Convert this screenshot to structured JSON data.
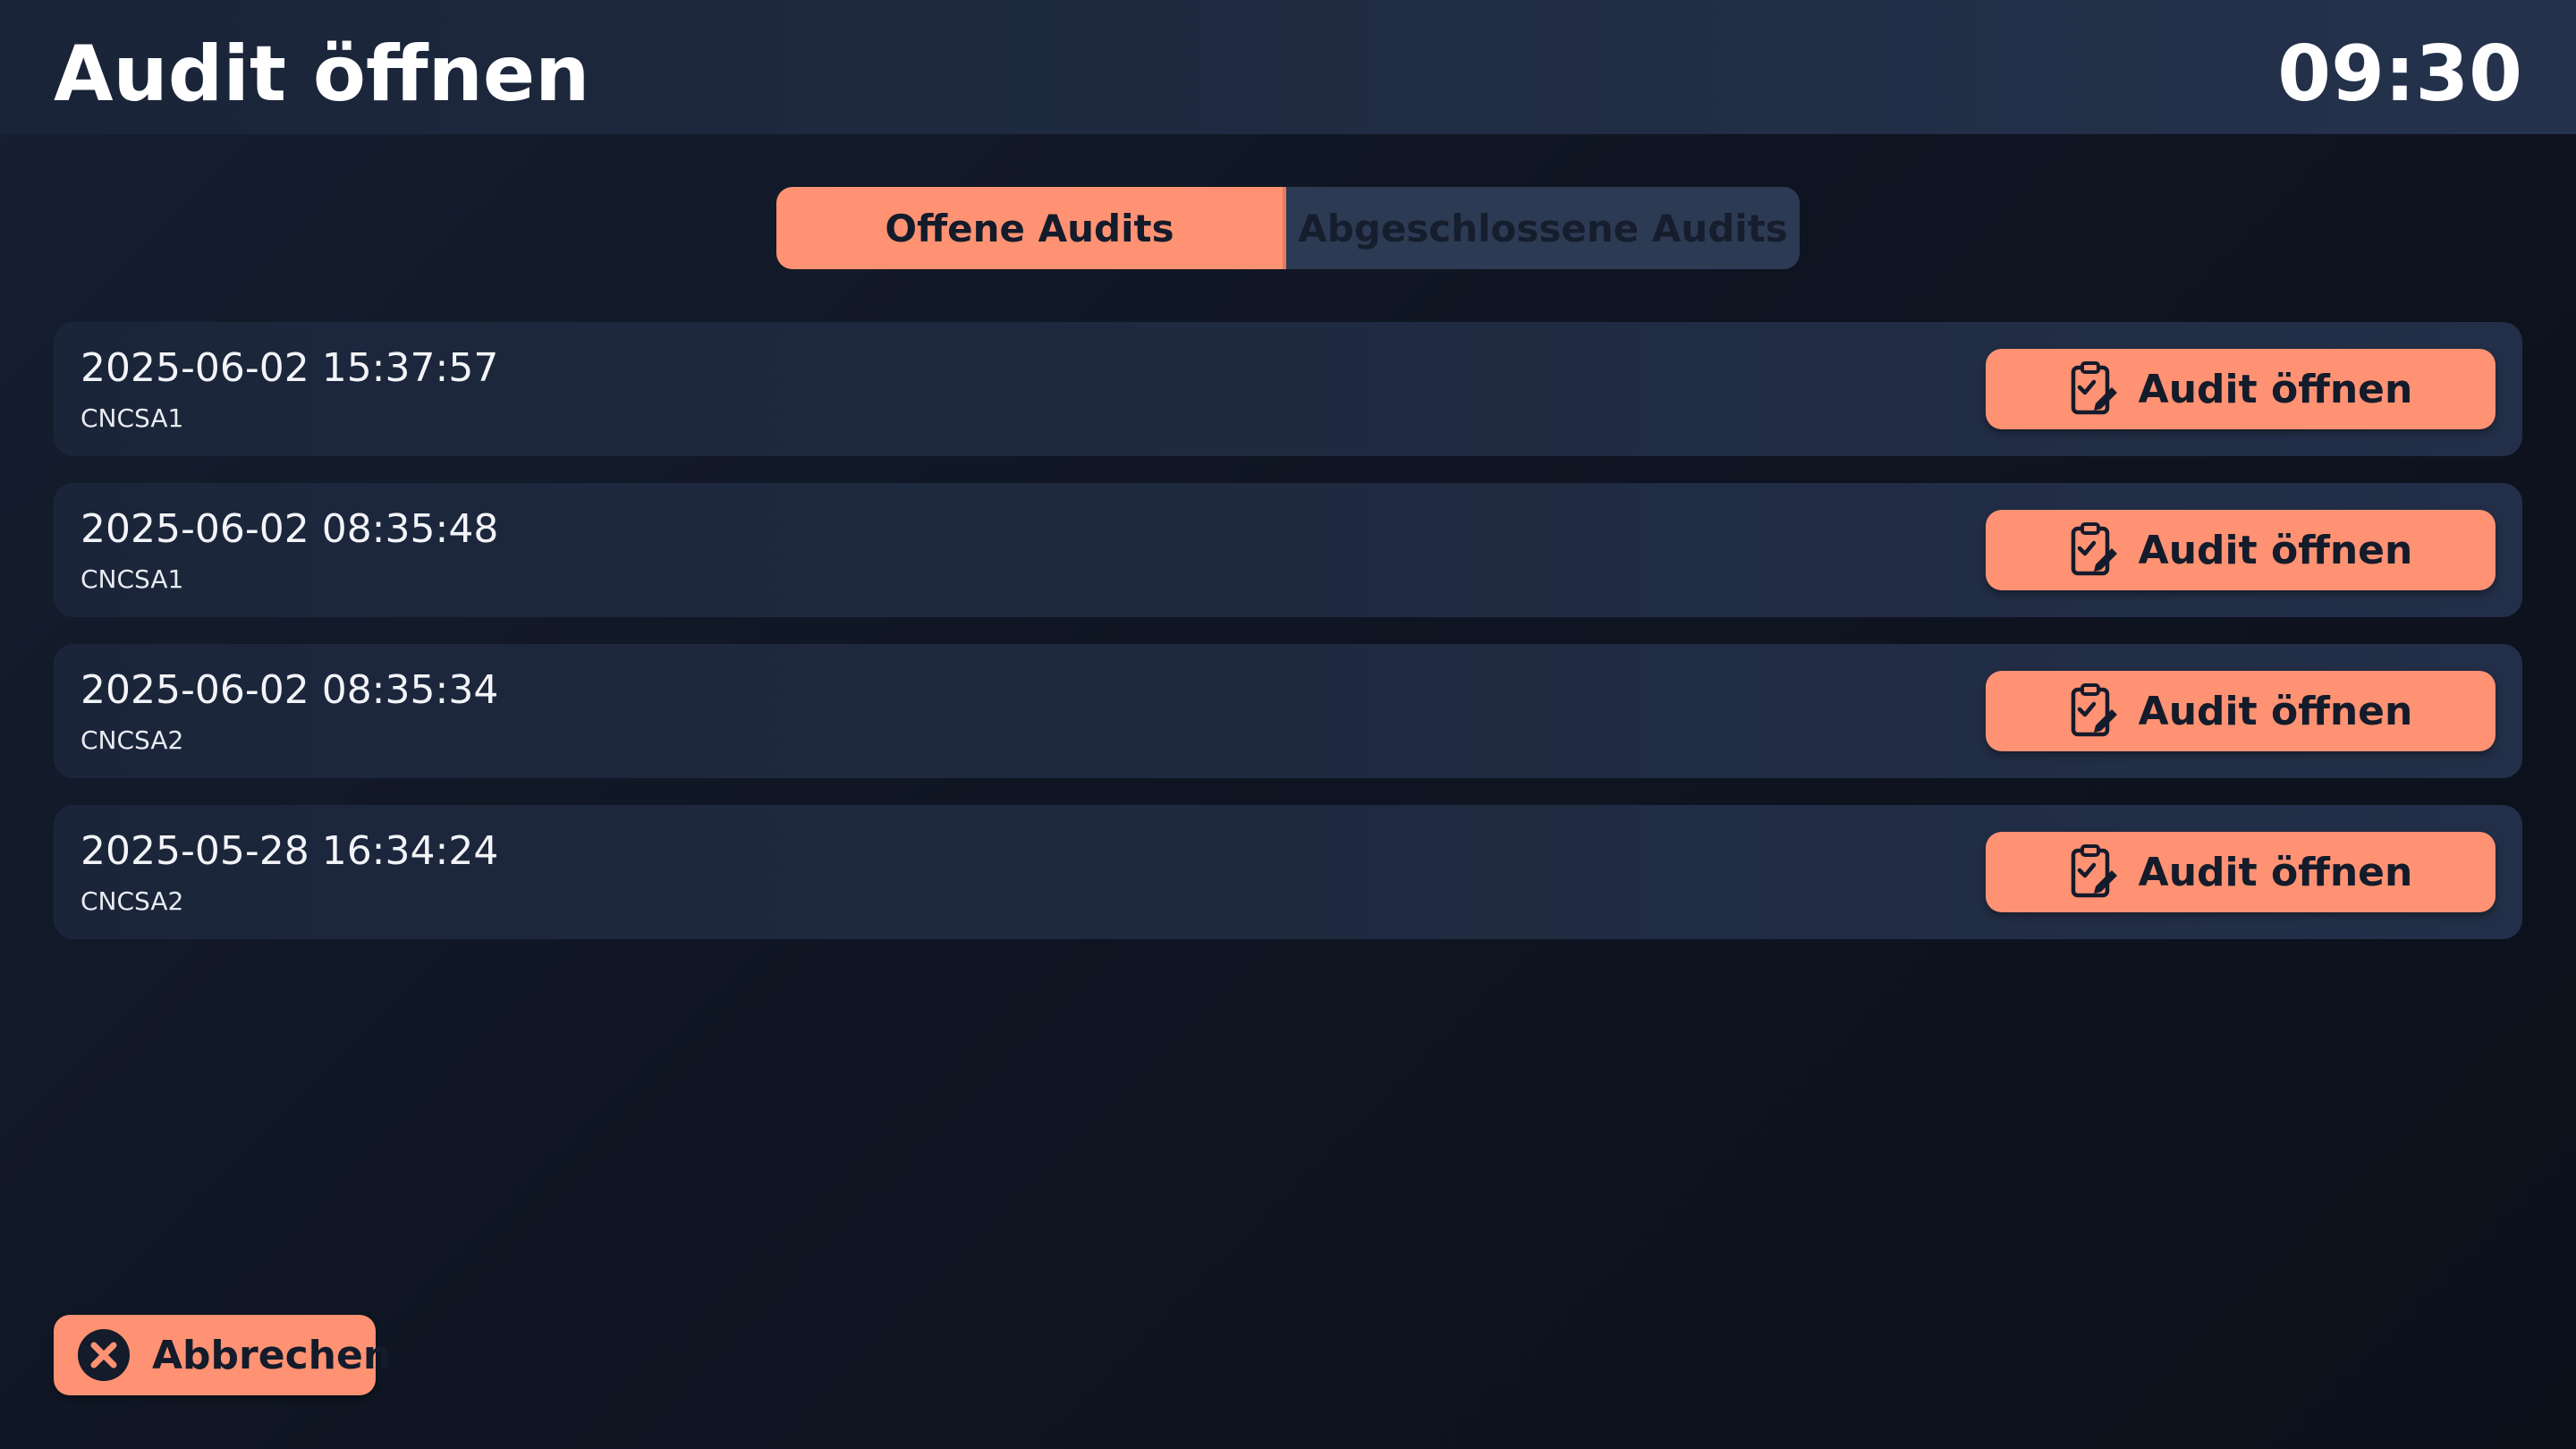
{
  "header": {
    "title": "Audit öffnen",
    "clock": "09:30"
  },
  "tabs": [
    {
      "label": "Offene Audits",
      "active": true
    },
    {
      "label": "Abgeschlossene Audits",
      "active": false
    }
  ],
  "audits": [
    {
      "datetime": "2025-06-02 15:37:57",
      "machine": "CNCSA1",
      "button_label": "Audit öffnen",
      "button_icon": "clipboard-edit-icon"
    },
    {
      "datetime": "2025-06-02 08:35:48",
      "machine": "CNCSA1",
      "button_label": "Audit öffnen",
      "button_icon": "clipboard-edit-icon"
    },
    {
      "datetime": "2025-06-02 08:35:34",
      "machine": "CNCSA2",
      "button_label": "Audit öffnen",
      "button_icon": "clipboard-edit-icon"
    },
    {
      "datetime": "2025-05-28 16:34:24",
      "machine": "CNCSA2",
      "button_label": "Audit öffnen",
      "button_icon": "clipboard-edit-icon"
    }
  ],
  "footer": {
    "cancel_label": "Abbrechen",
    "cancel_icon": "close-circle-icon"
  },
  "colors": {
    "accent": "#fe9273",
    "header_bg": "#25324c",
    "row_bg": "#232f48",
    "page_bg": "#0f1522",
    "dark_text": "#141b2b"
  }
}
